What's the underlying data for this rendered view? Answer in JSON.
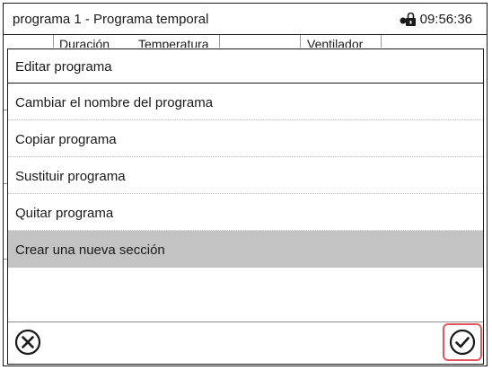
{
  "header": {
    "title": "programa 1 - Programa temporal",
    "time": "09:56:36",
    "lock_icon": "lock-icon"
  },
  "background_table": {
    "columns": [
      "Duración",
      "Temperatura",
      "Ventilador"
    ]
  },
  "dialog": {
    "title": "Editar programa",
    "items": [
      {
        "label": "Cambiar el nombre del programa",
        "selected": false
      },
      {
        "label": "Copiar programa",
        "selected": false
      },
      {
        "label": "Sustituir programa",
        "selected": false
      },
      {
        "label": "Quitar programa",
        "selected": false
      },
      {
        "label": "Crear una nueva sección",
        "selected": true
      }
    ],
    "cancel_icon": "close-circle-icon",
    "confirm_icon": "check-circle-icon",
    "confirm_highlight_color": "#e0575e",
    "selected_color": "#c3c3c3"
  }
}
